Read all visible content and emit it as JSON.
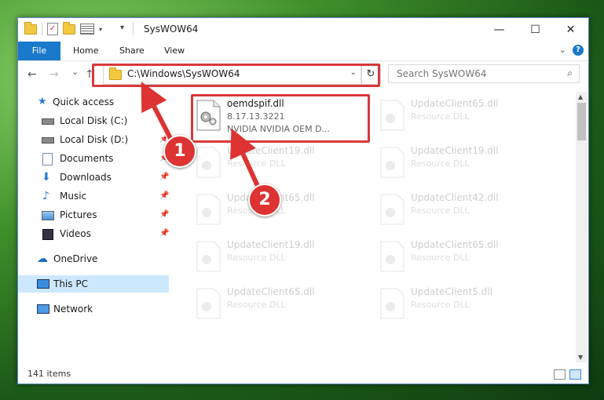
{
  "window": {
    "title": "SysWOW64",
    "controls": {
      "minimize": "—",
      "maximize": "☐",
      "close": "✕"
    }
  },
  "ribbon": {
    "tabs": [
      "File",
      "Home",
      "Share",
      "View"
    ],
    "help": "?"
  },
  "nav": {
    "back": "←",
    "forward": "→",
    "recent": "⌄",
    "up": "↑",
    "address": "C:\\Windows\\SysWOW64",
    "search_placeholder": "Search SysWOW64"
  },
  "sidebar": {
    "items": [
      {
        "label": "Quick access",
        "icon": "star-icon"
      },
      {
        "label": "Local Disk (C:)",
        "icon": "drive-icon"
      },
      {
        "label": "Local Disk (D:)",
        "icon": "drive-icon",
        "pinned": true
      },
      {
        "label": "Documents",
        "icon": "documents-icon",
        "pinned": true
      },
      {
        "label": "Downloads",
        "icon": "downloads-icon",
        "pinned": true
      },
      {
        "label": "Music",
        "icon": "music-icon",
        "pinned": true
      },
      {
        "label": "Pictures",
        "icon": "pictures-icon",
        "pinned": true
      },
      {
        "label": "Videos",
        "icon": "videos-icon",
        "pinned": true
      },
      {
        "label": "OneDrive",
        "icon": "cloud-icon"
      },
      {
        "label": "This PC",
        "icon": "pc-icon",
        "selected": true
      },
      {
        "label": "Network",
        "icon": "network-icon"
      }
    ]
  },
  "files": {
    "highlighted": {
      "name": "oemdspif.dll",
      "version": "8.17.13.3221",
      "description": "NVIDIA NVIDIA OEM D..."
    },
    "ghost": [
      {
        "name": "UpdateClient65.dll",
        "type": "Resource DLL"
      },
      {
        "name": "UpdateClient19.dll",
        "type": "Resource DLL"
      },
      {
        "name": "UpdateClient19.dll",
        "type": "Resource DLL"
      },
      {
        "name": "UpdateClient65.dll",
        "type": "Resource DLL"
      },
      {
        "name": "UpdateClient42.dll",
        "type": "Resource DLL"
      },
      {
        "name": "UpdateClient19.dll",
        "type": "Resource DLL"
      },
      {
        "name": "UpdateClient65.dll",
        "type": "Resource DLL"
      },
      {
        "name": "UpdateClient65.dll",
        "type": "Resource DLL"
      },
      {
        "name": "UpdateClient5.dll",
        "type": "Resource DLL"
      }
    ]
  },
  "status": {
    "items": "141 items"
  },
  "callouts": [
    "1",
    "2"
  ],
  "colors": {
    "accent": "#1979ca",
    "highlight": "#d9383a",
    "selection": "#cce8ff"
  }
}
